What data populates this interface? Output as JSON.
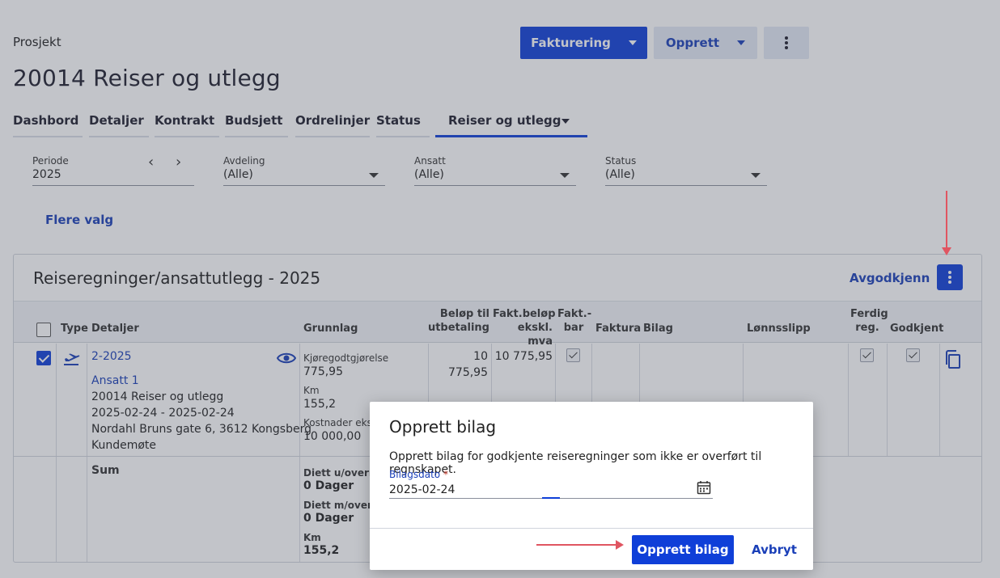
{
  "header": {
    "breadcrumb": "Prosjekt",
    "title": "20014 Reiser og utlegg",
    "fakturering_label": "Fakturering",
    "opprett_label": "Opprett"
  },
  "tabs": [
    {
      "label": "Dashbord"
    },
    {
      "label": "Detaljer"
    },
    {
      "label": "Kontrakt"
    },
    {
      "label": "Budsjett"
    },
    {
      "label": "Ordrelinjer"
    },
    {
      "label": "Status"
    },
    {
      "label": "Reiser og utlegg"
    }
  ],
  "filters": {
    "periode": {
      "label": "Periode",
      "value": "2025"
    },
    "avdeling": {
      "label": "Avdeling",
      "value": "(Alle)"
    },
    "ansatt": {
      "label": "Ansatt",
      "value": "(Alle)"
    },
    "status": {
      "label": "Status",
      "value": "(Alle)"
    },
    "more": "Flere valg"
  },
  "card": {
    "title": "Reiseregninger/ansattutlegg - 2025",
    "avgodkjenn": "Avgodkjenn",
    "columns": {
      "type": "Type",
      "detaljer": "Detaljer",
      "grunnlag": "Grunnlag",
      "belop_1": "Beløp til",
      "belop_2": "utbetaling",
      "fakt_belop_1": "Fakt.beløp",
      "fakt_belop_2": "ekskl. mva",
      "fakt_bar_1": "Fakt.-",
      "fakt_bar_2": "bar",
      "faktura": "Faktura",
      "bilag": "Bilag",
      "lonnsslipp": "Lønnsslipp",
      "ferdig_1": "Ferdig",
      "ferdig_2": "reg.",
      "godkjent": "Godkjent"
    },
    "row": {
      "id": "2-2025",
      "employee": "Ansatt 1",
      "project": "20014 Reiser og utlegg",
      "dates": "2025-02-24 - 2025-02-24",
      "address": "Nordahl Bruns gate 6, 3612 Kongsberg",
      "purpose": "Kundemøte",
      "grunnlag": [
        {
          "label": "Kjøregodtgjørelse",
          "value": "775,95"
        },
        {
          "label": "Km",
          "value": "155,2"
        },
        {
          "label": "Kostnader ekskl",
          "value": "10 000,00"
        }
      ],
      "belop": "10 775,95",
      "fakt_belop": "10 775,95"
    },
    "sum": {
      "label": "Sum",
      "grunnlag": [
        {
          "label": "Diett u/overnat",
          "value": "0 Dager"
        },
        {
          "label": "Diett m/overnat",
          "value": "0 Dager"
        },
        {
          "label": "Km",
          "value": "155,2"
        }
      ]
    }
  },
  "dialog": {
    "title": "Opprett bilag",
    "text": "Opprett bilag for godkjente reiseregninger som ikke er overført til regnskapet.",
    "field_label": "Bilagsdato",
    "field_required": "*",
    "field_value": "2025-02-24",
    "primary": "Opprett bilag",
    "cancel": "Avbryt"
  },
  "colors": {
    "primary": "#0f3fd8",
    "annotation": "#e05561"
  }
}
